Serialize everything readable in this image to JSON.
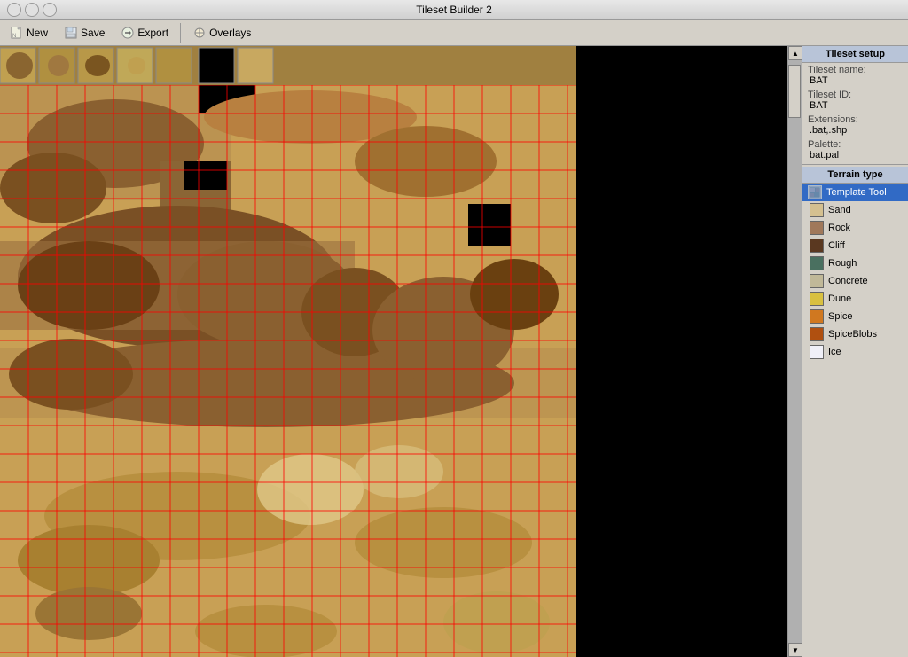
{
  "window": {
    "title": "Tileset Builder 2"
  },
  "toolbar": {
    "new_label": "New",
    "save_label": "Save",
    "export_label": "Export",
    "overlays_label": "Overlays"
  },
  "right_panel": {
    "setup_title": "Tileset setup",
    "tileset_name_label": "Tileset name:",
    "tileset_name_value": "BAT",
    "tileset_id_label": "Tileset ID:",
    "tileset_id_value": "BAT",
    "extensions_label": "Extensions:",
    "extensions_value": ".bat,.shp",
    "palette_label": "Palette:",
    "palette_value": "bat.pal",
    "terrain_type_title": "Terrain type",
    "template_tool_label": "Template Tool",
    "terrain_items": [
      {
        "id": "sand",
        "label": "Sand",
        "color": "#d4c090"
      },
      {
        "id": "rock",
        "label": "Rock",
        "color": "#a0785a"
      },
      {
        "id": "cliff",
        "label": "Cliff",
        "color": "#5a3820"
      },
      {
        "id": "rough",
        "label": "Rough",
        "color": "#4a7060"
      },
      {
        "id": "concrete",
        "label": "Concrete",
        "color": "#c0b898"
      },
      {
        "id": "dune",
        "label": "Dune",
        "color": "#d8c040"
      },
      {
        "id": "spice",
        "label": "Spice",
        "color": "#d07820"
      },
      {
        "id": "spiceblobs",
        "label": "SpiceBlobs",
        "color": "#b05010"
      },
      {
        "id": "ice",
        "label": "Ice",
        "color": "#f0f0f8"
      }
    ]
  },
  "scrollbar": {
    "up_arrow": "▲",
    "down_arrow": "▼"
  }
}
